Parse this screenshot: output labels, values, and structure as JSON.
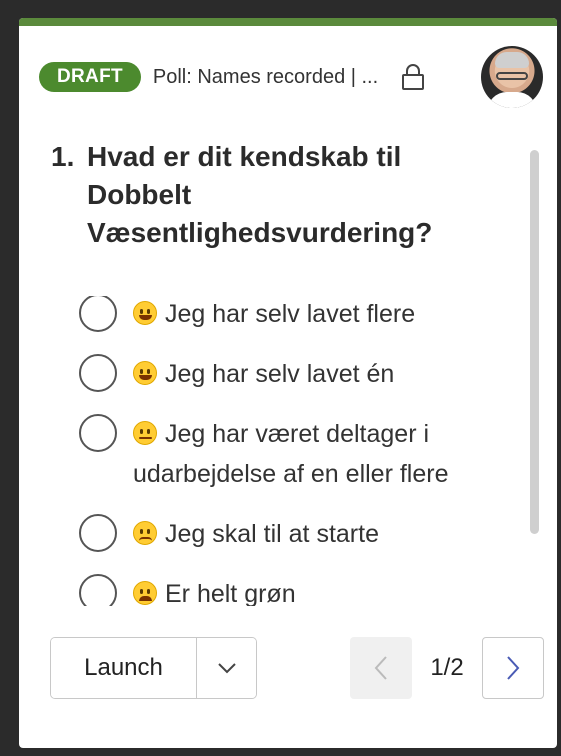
{
  "card": {
    "accent_color": "#5b8a3c",
    "badge_color": "#4c8a2e",
    "badge_label": "DRAFT",
    "poll_title": "Poll: Names recorded | ...",
    "lock_icon": "lock-icon",
    "avatar_icon": "user-avatar"
  },
  "question": {
    "number": "1.",
    "text": "Hvad er dit kendskab til Dobbelt Væsentlighedsvurdering?"
  },
  "options": [
    {
      "emoji": "grinning-face-icon",
      "label": "Jeg har selv lavet flere"
    },
    {
      "emoji": "smiling-face-icon",
      "label": "Jeg har selv lavet én"
    },
    {
      "emoji": "neutral-face-icon",
      "label": "Jeg har været deltager i udarbejdelse af en eller flere"
    },
    {
      "emoji": "sad-face-icon",
      "label": "Jeg skal til at starte"
    },
    {
      "emoji": "crying-face-icon",
      "label": "Er helt grøn"
    }
  ],
  "footer": {
    "launch_label": "Launch",
    "page_indicator": "1/2"
  }
}
